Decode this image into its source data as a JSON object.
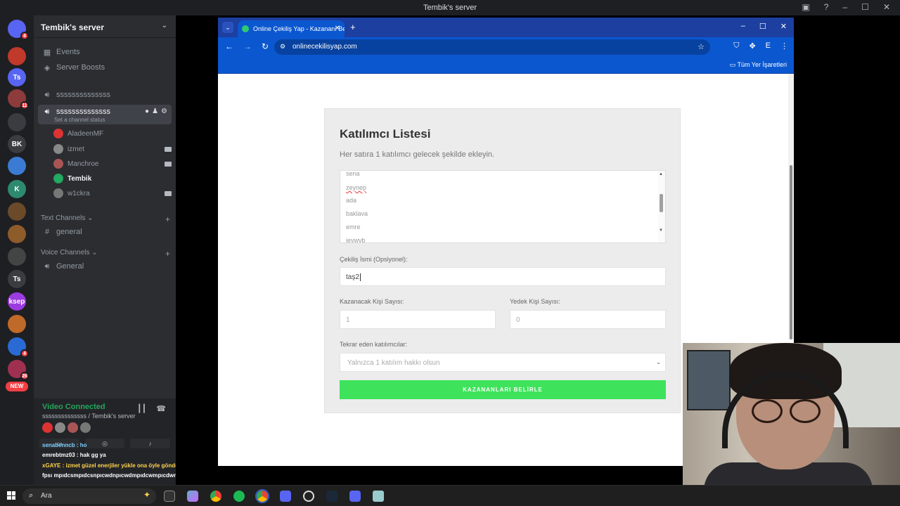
{
  "titlebar": {
    "title": "Tembik's server"
  },
  "rail": {
    "servers": [
      {
        "label": "",
        "color": "#5865f2",
        "icon": "discord-logo-icon",
        "badge": "4"
      },
      {
        "label": "",
        "color": "#c0392b",
        "icon": "server-avatar-icon",
        "badge": ""
      },
      {
        "label": "Ts",
        "color": "#5865f2",
        "icon": "server-ts-icon",
        "badge": ""
      },
      {
        "label": "",
        "color": "#8e3b3b",
        "icon": "server-avatar-icon",
        "badge": "11"
      },
      {
        "label": "",
        "color": "#3a3c42",
        "icon": "server-avatar-icon",
        "badge": ""
      },
      {
        "label": "BK",
        "color": "#3a3c42",
        "icon": "server-bk-icon",
        "badge": ""
      },
      {
        "label": "",
        "color": "#3b7bd4",
        "icon": "server-avatar-icon",
        "badge": ""
      },
      {
        "label": "K",
        "color": "#2d8a6e",
        "icon": "server-k-icon",
        "badge": ""
      },
      {
        "label": "",
        "color": "#6b4a2a",
        "icon": "server-avatar-icon",
        "badge": ""
      },
      {
        "label": "",
        "color": "#8e5b2a",
        "icon": "server-avatar-icon",
        "badge": ""
      },
      {
        "label": "",
        "color": "#444",
        "icon": "server-avatar-icon",
        "badge": ""
      },
      {
        "label": "Ts",
        "color": "#3a3c42",
        "icon": "server-ts-icon",
        "badge": ""
      },
      {
        "label": "ksep",
        "color": "#9b3be0",
        "icon": "server-ksep-icon",
        "badge": ""
      },
      {
        "label": "",
        "color": "#c06a2a",
        "icon": "server-avatar-icon",
        "badge": ""
      },
      {
        "label": "",
        "color": "#2a6ad4",
        "icon": "server-avatar-icon",
        "badge": "4"
      },
      {
        "label": "",
        "color": "#a03050",
        "icon": "server-avatar-icon",
        "badge": "26"
      }
    ],
    "new_label": "NEW"
  },
  "sidebar": {
    "server_name": "Tembik's server",
    "events": "Events",
    "boosts": "Server Boosts",
    "voice1": "ssssssssssssss",
    "voice2": "ssssssssssssss",
    "status_hint": "Set a channel status",
    "users": [
      "AladeenMF",
      "izmet",
      "Manchroe",
      "Tembik",
      "w1ckra"
    ],
    "text_channels": "Text Channels",
    "text_general": "general",
    "voice_channels": "Voice Channels",
    "voice_general": "General"
  },
  "voice_panel": {
    "status": "Video Connected",
    "location": "ssssssssssssss / Tembik's server"
  },
  "chat_overlay": [
    "senabenncb : ho",
    "emrebtmz03 : hak gg ya",
    "xGAYE : izmet güzel enerjiler yükle ona öyle gönder",
    "fpsı mpıdcsmpıdcsnpıcwdnpıcwdmpıdcwmpıcdwm"
  ],
  "browser": {
    "tab_title": "Online Çekiliş Yap - Kazananı Be",
    "url": "onlinecekilisyap.com",
    "bookmarks_label": "Tüm Yer İşaretleri"
  },
  "form": {
    "heading": "Katılımcı Listesi",
    "description": "Her satıra 1 katılımcı gelecek şekilde ekleyin.",
    "participants": [
      "sena",
      "zeynep",
      "ada",
      "baklava",
      "emre",
      "jevwvb"
    ],
    "raffle_name_label": "Çekiliş İsmi (Opsiyonel):",
    "raffle_name_value": "taş2",
    "winners_label": "Kazanacak Kişi Sayısı:",
    "winners_placeholder": "1",
    "backup_label": "Yedek Kişi Sayısı:",
    "backup_placeholder": "0",
    "repeat_label": "Tekrar eden katılımcılar:",
    "repeat_value": "Yalnızca 1 katılım hakkı olsun",
    "submit_label": "KAZANANLARI BELİRLE"
  },
  "taskbar": {
    "search_placeholder": "Ara"
  },
  "colors": {
    "discord_bg": "#2b2d31",
    "chrome_blue": "#0b57d0",
    "button_green": "#3ee35b",
    "purple_bar": "#9b4fe0"
  }
}
